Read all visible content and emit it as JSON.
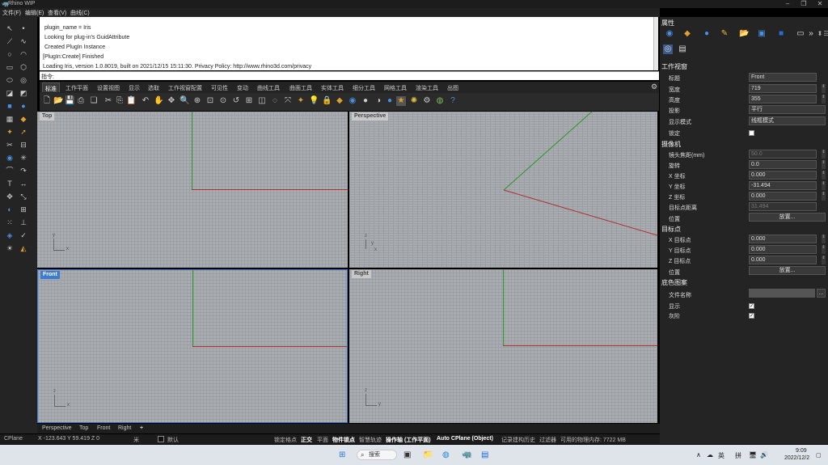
{
  "window": {
    "title": "Rhino WIP"
  },
  "menus": [
    "文件(F)",
    "编辑(E)",
    "查看(V)",
    "曲线(C)"
  ],
  "command_history": [
    "plugin_name = Iris",
    "Looking for plug-in's GuidAttribute",
    "Created PlugIn Instance",
    "[PlugIn:Create] Finished",
    "Loading Iris, version 1.0.8019, built on 2021/12/15 15:11:30. Privacy Policy: http://www.rhino3d.com/privacy"
  ],
  "command_prompt": {
    "label": "指令:",
    "value": ""
  },
  "tabs": [
    "标准",
    "工作平面",
    "设置视图",
    "显示",
    "选取",
    "工作视窗配置",
    "可见性",
    "变动",
    "曲线工具",
    "曲面工具",
    "实体工具",
    "细分工具",
    "网格工具",
    "渲染工具",
    "出图"
  ],
  "viewports": {
    "top": "Top",
    "perspective": "Perspective",
    "front": "Front",
    "right": "Right"
  },
  "axis_labels": {
    "x": "x",
    "y": "y",
    "z": "z"
  },
  "viewport_tabs": [
    "Perspective",
    "Top",
    "Front",
    "Right",
    "+"
  ],
  "status": {
    "cplane": "CPlane",
    "coords": "X -123.643  Y 59.419  Z 0",
    "units": "米",
    "layer": "默认",
    "items": [
      "锁定格点",
      "正交",
      "平面",
      "物件锁点",
      "智慧轨迹",
      "操作轴 (工作平面)",
      "Auto CPlane (Object)",
      "记录建构历史",
      "过滤器",
      "可用的物理内存: 7722 MB"
    ]
  },
  "properties": {
    "title": "属性",
    "section_viewport": "工作视窗",
    "title_label": "标题",
    "title_value": "Front",
    "width_label": "宽度",
    "width_value": "719",
    "height_label": "高度",
    "height_value": "355",
    "projection_label": "投影",
    "projection_value": "平行",
    "display_label": "显示模式",
    "display_value": "线框模式",
    "lock_label": "锁定",
    "section_camera": "摄像机",
    "lens_label": "镜头焦距(mm)",
    "lens_value": "50.0",
    "rotate_label": "旋转",
    "rotate_value": "0.0",
    "cx_label": "X 坐标",
    "cx_value": "0.000",
    "cy_label": "Y 坐标",
    "cy_value": "-31.494",
    "cz_label": "Z 坐标",
    "cz_value": "0.000",
    "tdist_label": "目标点距离",
    "tdist_value": "31.494",
    "pos_label": "位置",
    "place_btn": "放置...",
    "section_target": "目标点",
    "tx_label": "X 目标点",
    "tx_value": "0.000",
    "ty_label": "Y 目标点",
    "ty_value": "0.000",
    "tz_label": "Z 目标点",
    "tz_value": "0.000",
    "tpos_label": "位置",
    "tplace_btn": "放置...",
    "section_bg": "底色图案",
    "file_label": "文件名称",
    "file_btn": "...",
    "show_label": "显示",
    "gray_label": "灰阶"
  },
  "taskbar": {
    "search": "搜索",
    "lang": "英",
    "ime": "拼",
    "time": "9:09",
    "date": "2022/12/2"
  }
}
